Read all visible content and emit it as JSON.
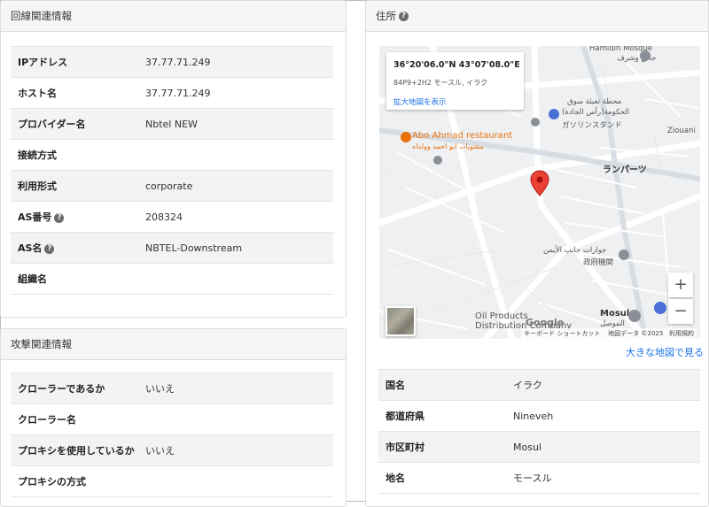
{
  "line_info": {
    "title": "回線関連情報",
    "rows": [
      {
        "label": "IPアドレス",
        "value": "37.77.71.249",
        "help": ""
      },
      {
        "label": "ホスト名",
        "value": "37.77.71.249",
        "help": ""
      },
      {
        "label": "プロバイダー名",
        "value": "Nbtel NEW",
        "help": ""
      },
      {
        "label": "接続方式",
        "value": "",
        "help": ""
      },
      {
        "label": "利用形式",
        "value": "corporate",
        "help": ""
      },
      {
        "label": "AS番号",
        "value": "208324",
        "help": "?"
      },
      {
        "label": "AS名",
        "value": "NBTEL-Downstream",
        "help": "?"
      },
      {
        "label": "組織名",
        "value": "",
        "help": ""
      }
    ]
  },
  "attack_info": {
    "title": "攻撃関連情報",
    "rows": [
      {
        "label": "クローラーであるか",
        "value": "いいえ"
      },
      {
        "label": "クローラー名",
        "value": ""
      },
      {
        "label": "プロキシを使用しているか",
        "value": "いいえ"
      },
      {
        "label": "プロキシの方式",
        "value": ""
      }
    ]
  },
  "address": {
    "title": "住所",
    "help": "?",
    "map": {
      "coordinates": "36°20'06.0\"N 43°07'08.0\"E",
      "plus_code": "84P9+2H2 モースル, イラク",
      "enlarge_link": "拡大地図を表示",
      "labels": {
        "mosque": "Hamidin Mosque",
        "mosque_ar": "جامع وشرف",
        "station": "محطة تعبئة سوق",
        "station_2": "الحكومة(رأس الجادة)",
        "station_jp": "ガソリンスタンド",
        "restaurant": "Abo Ahmad restaurant",
        "restaurant_ar": "مشويات ابو احمد وولداه",
        "ziouani": "Ziouani",
        "lampart": "ランパーツ",
        "gov": "جوارات جانب الأيمن",
        "gov_jp": "政府機関",
        "oil": "Oil Products",
        "oil_2": "Distribution Company",
        "mosul": "Mosul",
        "mosul_ar": "الموصل"
      },
      "zoom_in": "+",
      "zoom_out": "−",
      "google": "Google",
      "footer_shortcuts": "キーボード ショートカット",
      "footer_data": "地図データ ©2025",
      "footer_terms": "利用規約"
    },
    "big_map_link": "大きな地図で見る",
    "rows": [
      {
        "label": "国名",
        "value": "イラク"
      },
      {
        "label": "都道府県",
        "value": "Nineveh"
      },
      {
        "label": "市区町村",
        "value": "Mosul"
      },
      {
        "label": "地名",
        "value": "モースル"
      }
    ]
  },
  "colors": {
    "link": "#1a73e8",
    "pin": "#ea4335",
    "restaurant_label": "#e8710a",
    "row_alt": "#f3f3f3"
  }
}
